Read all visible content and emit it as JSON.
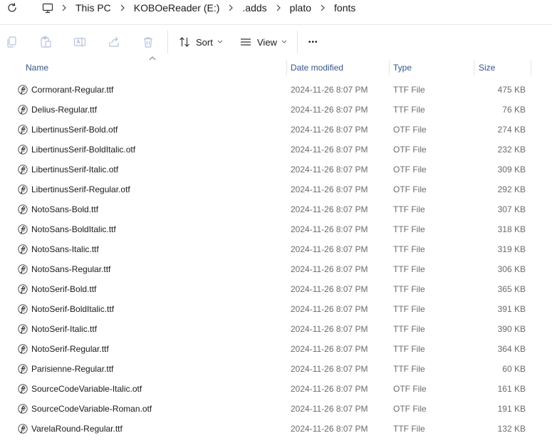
{
  "breadcrumbs": [
    "This PC",
    "KOBOeReader (E:)",
    ".adds",
    "plato",
    "fonts"
  ],
  "toolbar": {
    "sort_label": "Sort",
    "view_label": "View",
    "more_label": "•••"
  },
  "columns": {
    "name": "Name",
    "date": "Date modified",
    "type": "Type",
    "size": "Size"
  },
  "files": [
    {
      "name": "Cormorant-Regular.ttf",
      "date": "2024-11-26 8:07 PM",
      "type": "TTF File",
      "size": "475 KB"
    },
    {
      "name": "Delius-Regular.ttf",
      "date": "2024-11-26 8:07 PM",
      "type": "TTF File",
      "size": "76 KB"
    },
    {
      "name": "LibertinusSerif-Bold.otf",
      "date": "2024-11-26 8:07 PM",
      "type": "OTF File",
      "size": "274 KB"
    },
    {
      "name": "LibertinusSerif-BoldItalic.otf",
      "date": "2024-11-26 8:07 PM",
      "type": "OTF File",
      "size": "232 KB"
    },
    {
      "name": "LibertinusSerif-Italic.otf",
      "date": "2024-11-26 8:07 PM",
      "type": "OTF File",
      "size": "309 KB"
    },
    {
      "name": "LibertinusSerif-Regular.otf",
      "date": "2024-11-26 8:07 PM",
      "type": "OTF File",
      "size": "292 KB"
    },
    {
      "name": "NotoSans-Bold.ttf",
      "date": "2024-11-26 8:07 PM",
      "type": "TTF File",
      "size": "307 KB"
    },
    {
      "name": "NotoSans-BoldItalic.ttf",
      "date": "2024-11-26 8:07 PM",
      "type": "TTF File",
      "size": "318 KB"
    },
    {
      "name": "NotoSans-Italic.ttf",
      "date": "2024-11-26 8:07 PM",
      "type": "TTF File",
      "size": "319 KB"
    },
    {
      "name": "NotoSans-Regular.ttf",
      "date": "2024-11-26 8:07 PM",
      "type": "TTF File",
      "size": "306 KB"
    },
    {
      "name": "NotoSerif-Bold.ttf",
      "date": "2024-11-26 8:07 PM",
      "type": "TTF File",
      "size": "365 KB"
    },
    {
      "name": "NotoSerif-BoldItalic.ttf",
      "date": "2024-11-26 8:07 PM",
      "type": "TTF File",
      "size": "391 KB"
    },
    {
      "name": "NotoSerif-Italic.ttf",
      "date": "2024-11-26 8:07 PM",
      "type": "TTF File",
      "size": "390 KB"
    },
    {
      "name": "NotoSerif-Regular.ttf",
      "date": "2024-11-26 8:07 PM",
      "type": "TTF File",
      "size": "364 KB"
    },
    {
      "name": "Parisienne-Regular.ttf",
      "date": "2024-11-26 8:07 PM",
      "type": "TTF File",
      "size": "60 KB"
    },
    {
      "name": "SourceCodeVariable-Italic.otf",
      "date": "2024-11-26 8:07 PM",
      "type": "OTF File",
      "size": "161 KB"
    },
    {
      "name": "SourceCodeVariable-Roman.otf",
      "date": "2024-11-26 8:07 PM",
      "type": "OTF File",
      "size": "191 KB"
    },
    {
      "name": "VarelaRound-Regular.ttf",
      "date": "2024-11-26 8:07 PM",
      "type": "TTF File",
      "size": "132 KB"
    }
  ],
  "colors": {
    "header_text": "#33558c",
    "secondary_text": "#6b6b6b",
    "disabled_icon": "#9aa4b2"
  },
  "icons": {
    "refresh": "refresh-icon",
    "computer": "computer-icon",
    "separator": "chevron-right-icon",
    "file": "font-file-icon"
  }
}
